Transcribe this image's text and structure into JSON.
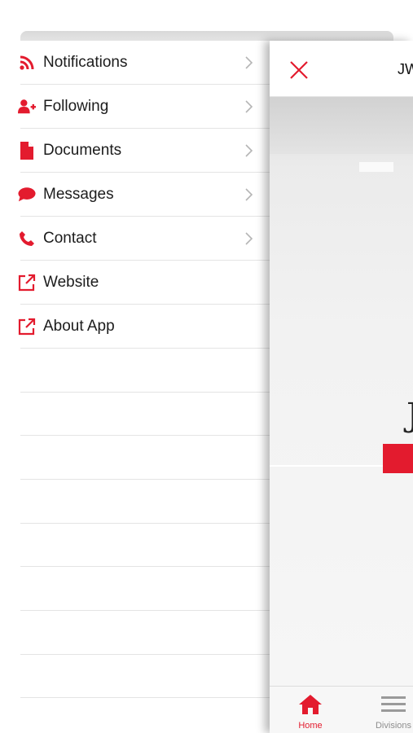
{
  "colors": {
    "accent": "#e31b2e",
    "text": "#1c1c1c",
    "muted": "#8e8e8e"
  },
  "menu": {
    "items": [
      {
        "label": "Notifications",
        "icon": "rss-icon",
        "has_chevron": true
      },
      {
        "label": "Following",
        "icon": "user-plus-icon",
        "has_chevron": true
      },
      {
        "label": "Documents",
        "icon": "document-icon",
        "has_chevron": true
      },
      {
        "label": "Messages",
        "icon": "chat-bubble-icon",
        "has_chevron": true
      },
      {
        "label": "Contact",
        "icon": "phone-icon",
        "has_chevron": true
      },
      {
        "label": "Website",
        "icon": "external-link-icon",
        "has_chevron": false
      },
      {
        "label": "About App",
        "icon": "external-link-icon",
        "has_chevron": false
      }
    ]
  },
  "panel": {
    "title": "JW",
    "close_icon": "close-icon",
    "logo_fragment": "J"
  },
  "tabbar": {
    "tabs": [
      {
        "label": "Home",
        "icon": "home-icon",
        "active": true
      },
      {
        "label": "Divisions",
        "icon": "menu-lines-icon",
        "active": false
      }
    ]
  }
}
